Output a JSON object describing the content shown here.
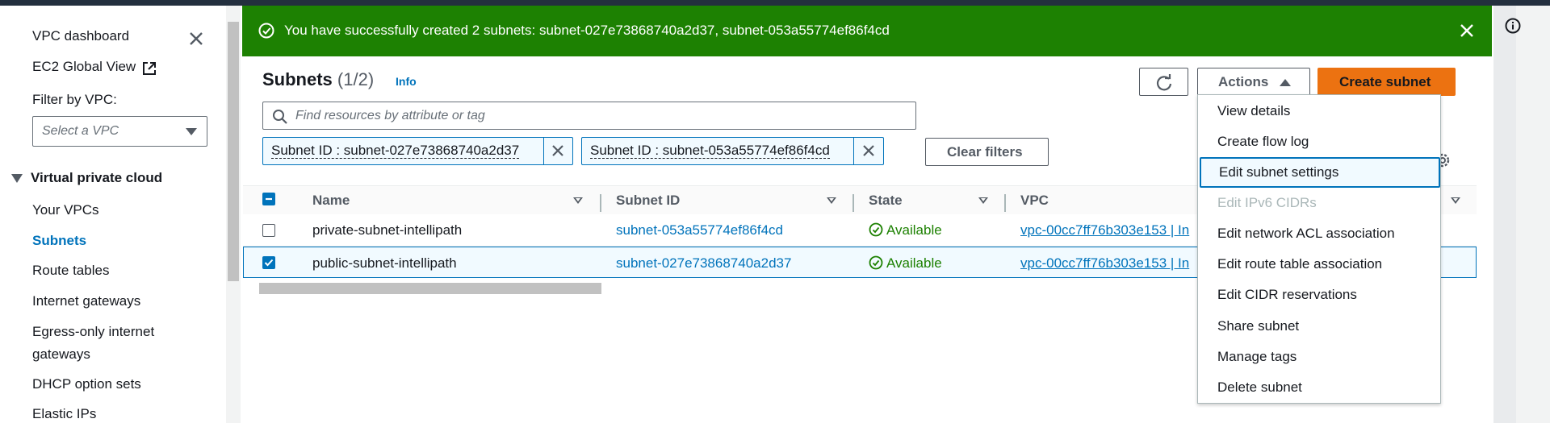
{
  "sidebar": {
    "dashboard": "VPC dashboard",
    "ec2_global_view": "EC2 Global View",
    "filter_label": "Filter by VPC:",
    "filter_placeholder": "Select a VPC",
    "section_title": "Virtual private cloud",
    "items": [
      {
        "label": "Your VPCs"
      },
      {
        "label": "Subnets",
        "active": true
      },
      {
        "label": "Route tables"
      },
      {
        "label": "Internet gateways"
      },
      {
        "label": "Egress-only internet"
      },
      {
        "label": "gateways"
      },
      {
        "label": "DHCP option sets"
      },
      {
        "label": "Elastic IPs"
      }
    ]
  },
  "flash": {
    "message": "You have successfully created 2 subnets: subnet-027e73868740a2d37, subnet-053a55774ef86f4cd"
  },
  "header": {
    "title": "Subnets",
    "count": "(1/2)",
    "info": "Info",
    "actions_label": "Actions",
    "create_label": "Create subnet"
  },
  "search": {
    "placeholder": "Find resources by attribute or tag"
  },
  "filters": {
    "tokens": [
      "Subnet ID : subnet-027e73868740a2d37",
      "Subnet ID : subnet-053a55774ef86f4cd"
    ],
    "clear_label": "Clear filters"
  },
  "table": {
    "columns": [
      "Name",
      "Subnet ID",
      "State",
      "VPC"
    ],
    "rows": [
      {
        "name": "private-subnet-intellipath",
        "subnet_id": "subnet-053a55774ef86f4cd",
        "state": "Available",
        "vpc": "vpc-00cc7ff76b303e153 | In",
        "selected": false
      },
      {
        "name": "public-subnet-intellipath",
        "subnet_id": "subnet-027e73868740a2d37",
        "state": "Available",
        "vpc": "vpc-00cc7ff76b303e153 | In",
        "selected": true
      }
    ]
  },
  "actions_menu": {
    "items": [
      {
        "label": "View details",
        "disabled": false
      },
      {
        "label": "Create flow log",
        "disabled": false
      },
      {
        "label": "Edit subnet settings",
        "disabled": false,
        "highlighted": true
      },
      {
        "label": "Edit IPv6 CIDRs",
        "disabled": true
      },
      {
        "label": "Edit network ACL association",
        "disabled": false
      },
      {
        "label": "Edit route table association",
        "disabled": false
      },
      {
        "label": "Edit CIDR reservations",
        "disabled": false
      },
      {
        "label": "Share subnet",
        "disabled": false
      },
      {
        "label": "Manage tags",
        "disabled": false
      },
      {
        "label": "Delete subnet",
        "disabled": false
      }
    ]
  },
  "colors": {
    "flash_green": "#1d8102",
    "link_blue": "#0073bb",
    "primary_orange": "#ec7211",
    "topbar": "#232f3e"
  }
}
